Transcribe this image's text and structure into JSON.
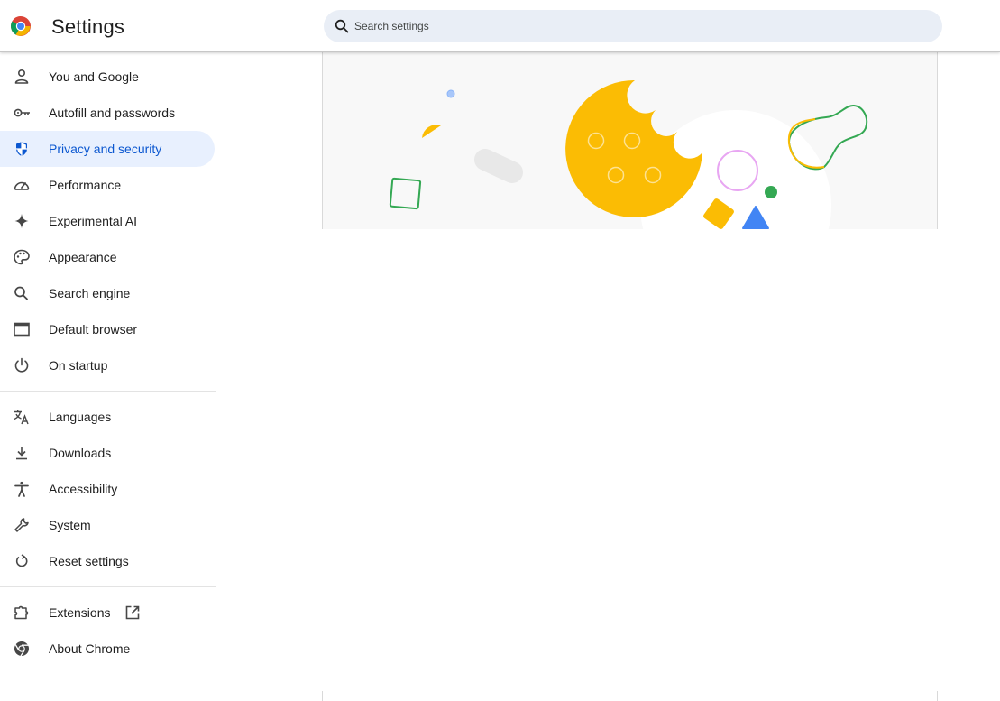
{
  "header": {
    "title": "Settings",
    "search_placeholder": "Search settings"
  },
  "sidebar": {
    "items": [
      {
        "label": "You and Google",
        "icon": "person-icon"
      },
      {
        "label": "Autofill and passwords",
        "icon": "key-icon"
      },
      {
        "label": "Privacy and security",
        "icon": "shield-icon",
        "active": true
      },
      {
        "label": "Performance",
        "icon": "speedometer-icon"
      },
      {
        "label": "Experimental AI",
        "icon": "sparkle-icon"
      },
      {
        "label": "Appearance",
        "icon": "palette-icon"
      },
      {
        "label": "Search engine",
        "icon": "search-icon"
      },
      {
        "label": "Default browser",
        "icon": "browser-window-icon"
      },
      {
        "label": "On startup",
        "icon": "power-icon"
      },
      {
        "label": "Languages",
        "icon": "translate-icon"
      },
      {
        "label": "Downloads",
        "icon": "download-icon"
      },
      {
        "label": "Accessibility",
        "icon": "accessibility-icon"
      },
      {
        "label": "System",
        "icon": "wrench-icon"
      },
      {
        "label": "Reset settings",
        "icon": "reset-icon"
      },
      {
        "label": "Extensions",
        "icon": "puzzle-icon"
      },
      {
        "label": "About Chrome",
        "icon": "chrome-icon"
      }
    ]
  },
  "colors": {
    "accent": "#0b57d0",
    "active_bg": "#e8f0fe",
    "cookie_yellow": "#fbbc04",
    "green": "#34a853",
    "blue": "#4285f4"
  }
}
